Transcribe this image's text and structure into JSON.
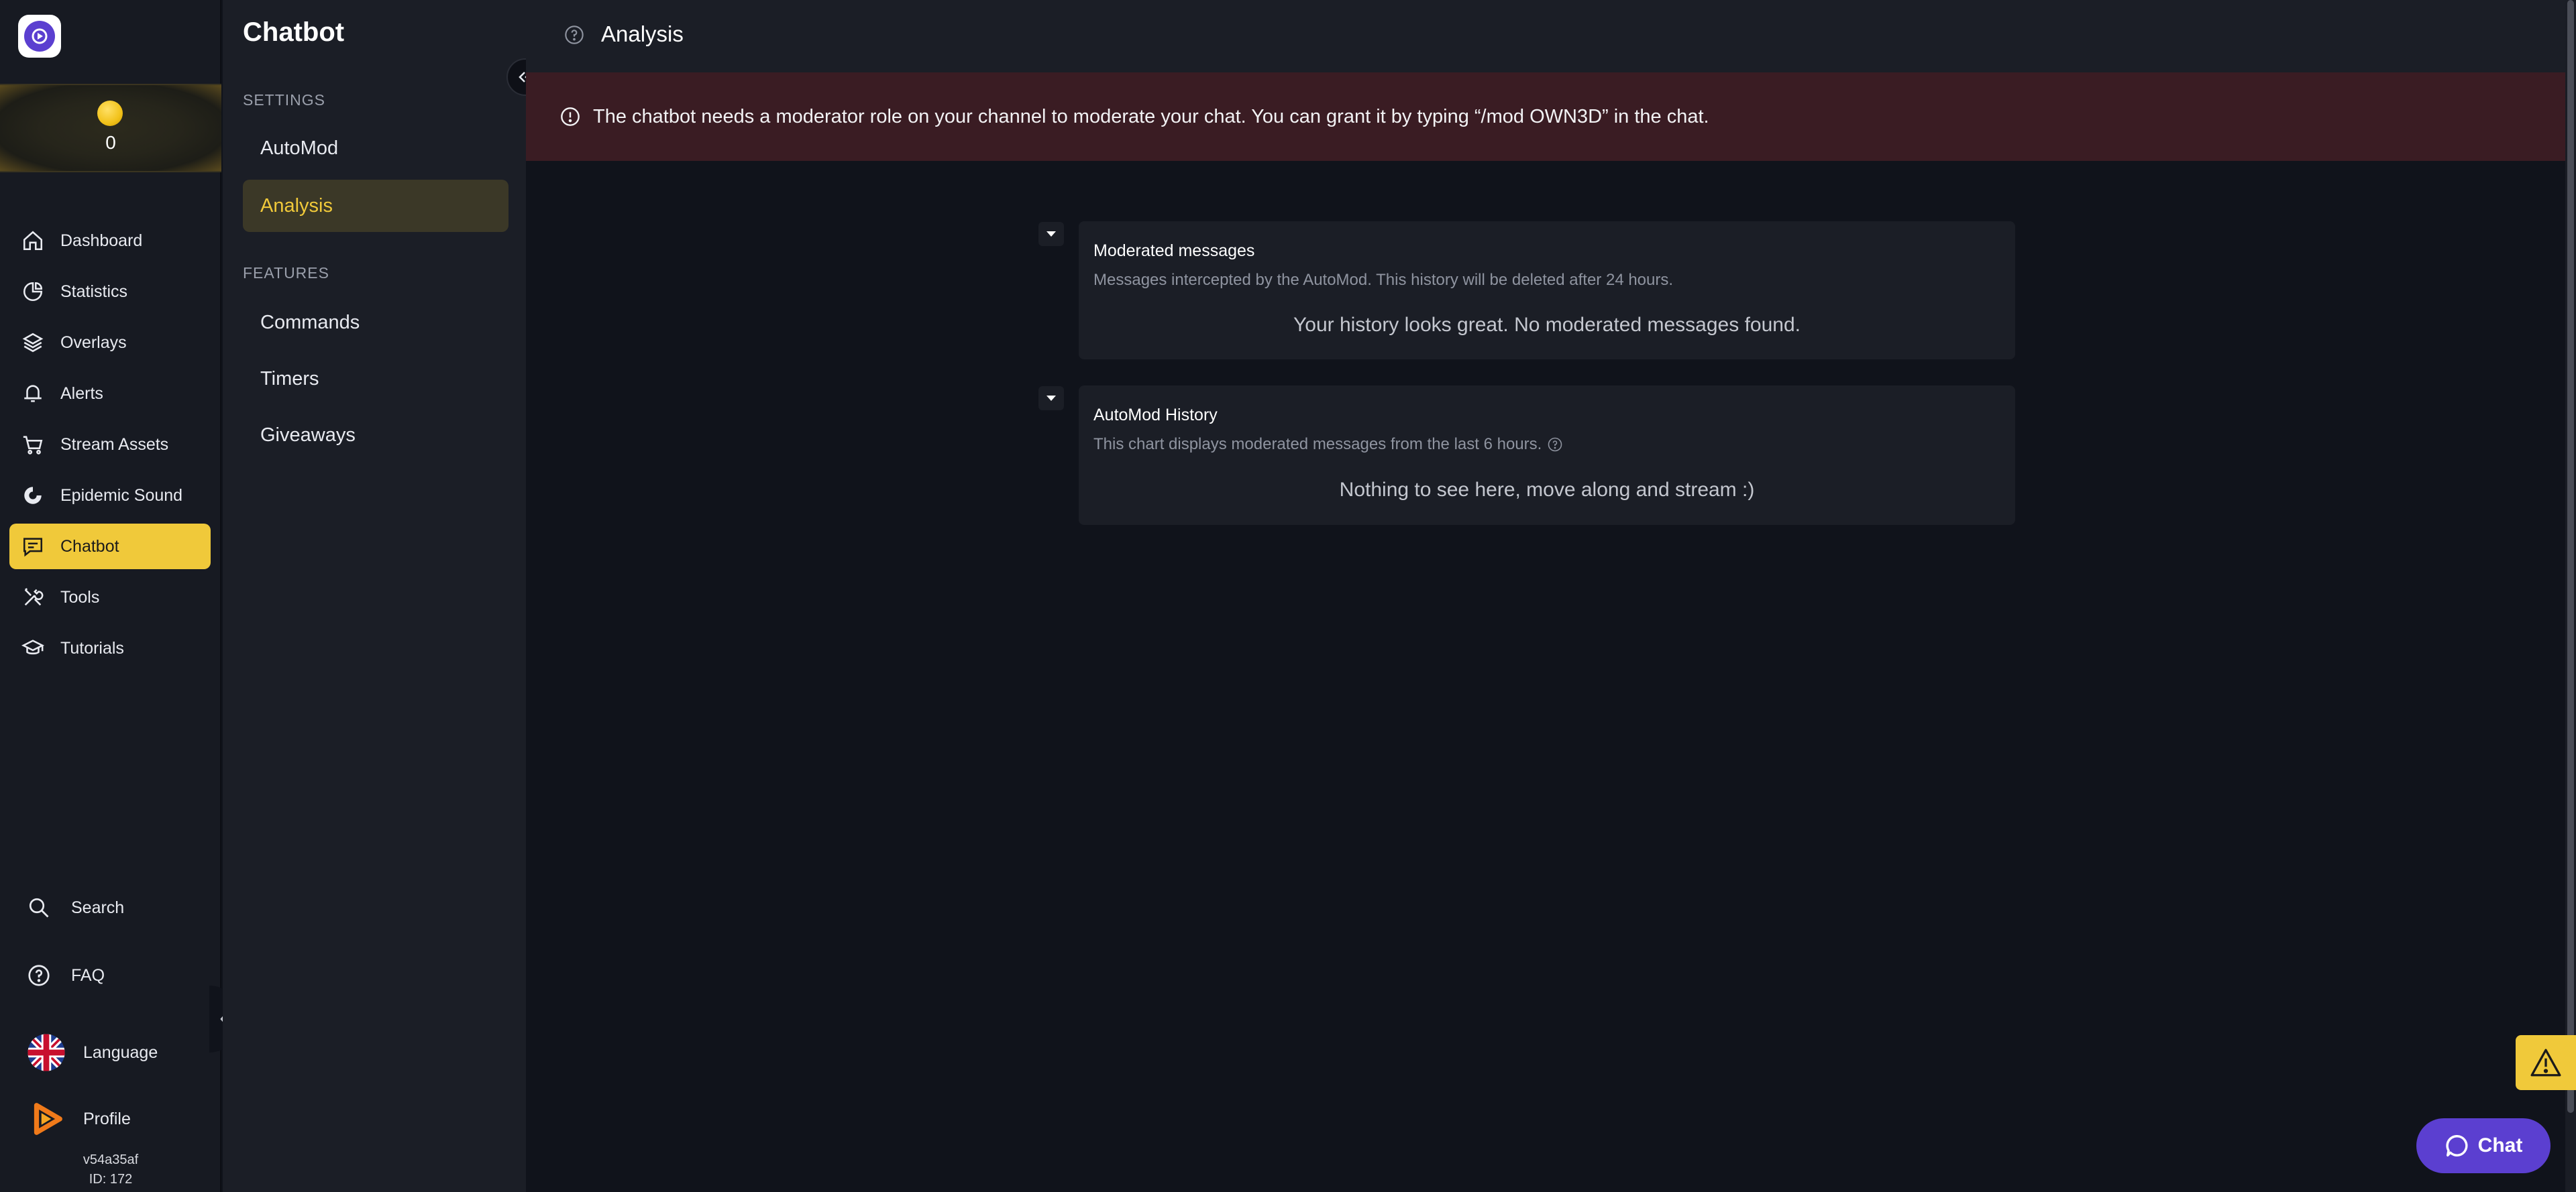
{
  "nav": {
    "coin_count": "0",
    "items": [
      {
        "label": "Dashboard",
        "icon": "home-icon"
      },
      {
        "label": "Statistics",
        "icon": "pie-chart-icon"
      },
      {
        "label": "Overlays",
        "icon": "layers-icon"
      },
      {
        "label": "Alerts",
        "icon": "bell-icon"
      },
      {
        "label": "Stream Assets",
        "icon": "cart-icon"
      },
      {
        "label": "Epidemic Sound",
        "icon": "epidemic-sound-icon"
      },
      {
        "label": "Chatbot",
        "icon": "chat-icon",
        "active": true
      },
      {
        "label": "Tools",
        "icon": "tools-icon"
      },
      {
        "label": "Tutorials",
        "icon": "graduation-cap-icon"
      }
    ],
    "bottom": {
      "search": "Search",
      "faq": "FAQ",
      "language": "Language",
      "profile": "Profile"
    },
    "version": "v54a35af",
    "user_id": "ID: 172"
  },
  "submenu": {
    "title": "Chatbot",
    "settings_heading": "SETTINGS",
    "settings_items": [
      "AutoMod",
      "Analysis"
    ],
    "active_item": "Analysis",
    "features_heading": "FEATURES",
    "features_items": [
      "Commands",
      "Timers",
      "Giveaways"
    ]
  },
  "header": {
    "title": "Analysis"
  },
  "alert": {
    "message": "The chatbot needs a moderator role on your channel to moderate your chat. You can grant it by typing “/mod OWN3D” in the chat."
  },
  "cards": {
    "moderated": {
      "title": "Moderated messages",
      "subtitle": "Messages intercepted by the AutoMod. This history will be deleted after 24 hours.",
      "empty": "Your history looks great. No moderated messages found."
    },
    "history": {
      "title": "AutoMod History",
      "subtitle": "This chart displays moderated messages from the last 6 hours.",
      "empty": "Nothing to see here, move along and stream :)"
    }
  },
  "chat_button": {
    "label": "Chat"
  },
  "colors": {
    "accent": "#f0c93a",
    "alert_bg": "#3a1c23",
    "brand_purple": "#5b3fd0"
  }
}
